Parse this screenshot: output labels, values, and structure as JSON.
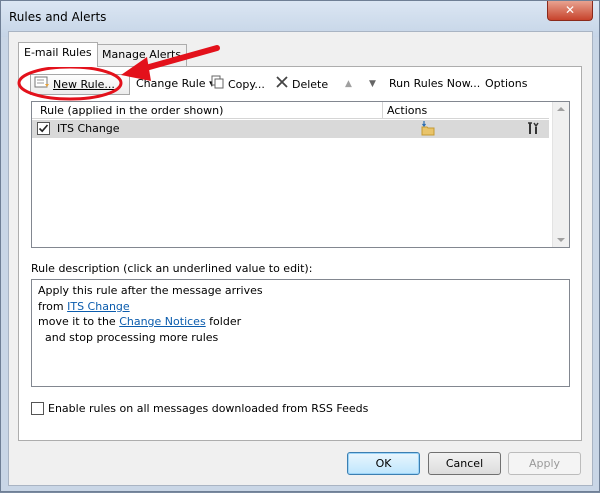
{
  "window": {
    "title": "Rules and Alerts",
    "close_glyph": "✕"
  },
  "tabs": [
    {
      "label": "E-mail Rules",
      "active": true
    },
    {
      "label": "Manage Alerts",
      "active": false
    }
  ],
  "toolbar": {
    "new_rule": "New Rule...",
    "change_rule": "Change Rule",
    "change_rule_arrow": "▾",
    "copy": "Copy...",
    "delete": "Delete",
    "move_up_glyph": "▲",
    "move_down_glyph": "▼",
    "run_rules_now": "Run Rules Now...",
    "options": "Options"
  },
  "rules_list": {
    "columns": [
      "Rule (applied in the order shown)",
      "Actions"
    ],
    "rows": [
      {
        "checked": true,
        "name": "ITS Change"
      }
    ]
  },
  "description": {
    "label": "Rule description (click an underlined value to edit):",
    "line1": "Apply this rule after the message arrives",
    "line2_prefix": "from ",
    "line2_link": "ITS Change",
    "line3_prefix": "move it to the ",
    "line3_link": "Change Notices",
    "line3_suffix": " folder",
    "line4": "  and stop processing more rules"
  },
  "rss_checkbox": {
    "label": "Enable rules on all messages downloaded from RSS Feeds",
    "checked": false
  },
  "buttons": {
    "ok": "OK",
    "cancel": "Cancel",
    "apply": "Apply"
  },
  "colors": {
    "annotation_red": "#e3111b",
    "link_blue": "#0b5cad",
    "selected_row": "#d9d9d9"
  },
  "icons": [
    "close-icon",
    "new-rule-icon",
    "copy-icon",
    "delete-icon",
    "move-up-icon",
    "move-down-icon",
    "checkbox-checked-icon",
    "folder-move-icon",
    "tools-icon"
  ]
}
